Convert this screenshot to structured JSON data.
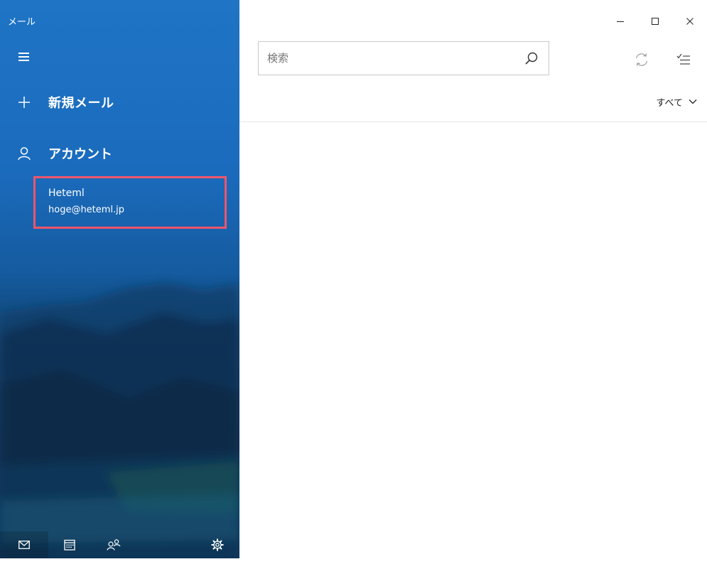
{
  "app": {
    "title": "メール"
  },
  "sidebar": {
    "new_mail_label": "新規メール",
    "accounts_label": "アカウント",
    "accounts": [
      {
        "name": "Heteml",
        "email": "hoge@heteml.jp"
      }
    ]
  },
  "search": {
    "placeholder": "検索",
    "value": ""
  },
  "filter": {
    "label": "すべて"
  },
  "icons": {
    "menu": "hamburger-icon",
    "new_mail": "plus-icon",
    "account": "person-icon",
    "search": "search-icon",
    "sync": "sync-icon",
    "select": "checklist-icon",
    "filter": "chevron-down-icon",
    "minimize": "minimize-icon",
    "maximize": "maximize-icon",
    "close": "close-icon",
    "nav_mail": "mail-icon",
    "nav_calendar": "calendar-icon",
    "nav_people": "people-icon",
    "nav_settings": "gear-icon"
  },
  "colors": {
    "sidebar_accent": "#1f74c6",
    "highlight_border": "#f2556b",
    "window_border": "#2a8fa6"
  }
}
